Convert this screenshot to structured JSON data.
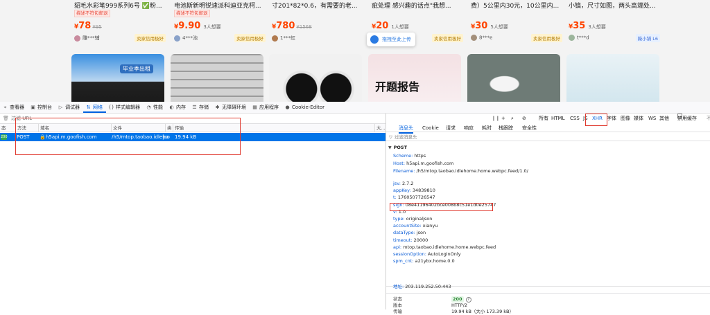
{
  "products": {
    "cards": [
      {
        "title": "貂毛水彩笔999系列6号 ✅粉...",
        "tag": "描述不符包邮退",
        "currency": "¥",
        "price": "78",
        "original": "¥95",
        "wants": "",
        "seller": "雕***辅",
        "badge": "卖家信用极好",
        "badge_type": "credit"
      },
      {
        "title": "电池斯新明锐速派科迪亚克柯...",
        "tag": "描述不符包邮退",
        "currency": "¥",
        "price": "9.90",
        "original": "",
        "wants": "3人想要",
        "seller": "4***池",
        "badge": "卖家信用极好",
        "badge_type": "credit"
      },
      {
        "title": "寸201*82*0.6，有需要的老...",
        "tag": "",
        "currency": "¥",
        "price": "780",
        "original": "¥1568",
        "wants": "",
        "seller": "1***虹",
        "badge": "",
        "badge_type": ""
      },
      {
        "title": "疵处理 感兴趣的话点\"我想...",
        "tag": "",
        "currency": "¥",
        "price": "20",
        "original": "",
        "wants": "1人想要",
        "seller": "",
        "badge": "卖家信用极好",
        "badge_type": "credit"
      },
      {
        "title": "费）5公里内30元，10公里内...",
        "tag": "",
        "currency": "¥",
        "price": "30",
        "original": "",
        "wants": "5人想要",
        "seller": "8***e",
        "badge": "卖家信用极好",
        "badge_type": "credit"
      },
      {
        "title": "小镐，尺寸如图，两头高端处...",
        "tag": "",
        "currency": "¥",
        "price": "35",
        "original": "",
        "wants": "3人想要",
        "seller": "t***d",
        "badge": "薇小铺 L6",
        "badge_type": "level"
      }
    ],
    "thumbs": [
      {
        "caption": "毕业季出租",
        "accent": "#2f6fbf"
      },
      {
        "caption": "",
        "accent": "#b9b9b9"
      },
      {
        "caption": "",
        "accent": "#1e1e1e"
      },
      {
        "caption": "开题报告",
        "accent": "#f2d23c"
      },
      {
        "caption": "",
        "accent": "#7c8a86"
      },
      {
        "caption": "",
        "accent": "#6bc9c6"
      }
    ],
    "upload_tip": "拖拽至此上传"
  },
  "devtools": {
    "tabs": [
      {
        "icon": "⌖",
        "label": "查看器"
      },
      {
        "icon": "▣",
        "label": "控制台"
      },
      {
        "icon": "▷",
        "label": "调试器"
      },
      {
        "icon": "⇅",
        "label": "网络"
      },
      {
        "icon": "{}",
        "label": "样式编辑器"
      },
      {
        "icon": "◔",
        "label": "性能"
      },
      {
        "icon": "◐",
        "label": "内存"
      },
      {
        "icon": "☰",
        "label": "存储"
      },
      {
        "icon": "✱",
        "label": "无障碍环境"
      },
      {
        "icon": "▦",
        "label": "应用程序"
      },
      {
        "icon": "●",
        "label": "Cookie-Editor"
      }
    ],
    "active_tab": "网络",
    "filter_placeholder": "过滤 URL",
    "columns": {
      "status": "态",
      "method": "方法",
      "domain": "域名",
      "file": "文件",
      "initiator": "类",
      "transferred": "传输",
      "size": "大..."
    },
    "request": {
      "status": "200",
      "method": "POST",
      "domain": "h5api.m.goofish.com",
      "file": "/h5/mtop.taobao.idleho",
      "type": "jso",
      "transferred": "19.94 kB"
    },
    "toolbar": {
      "pause": "❙❙",
      "add": "+",
      "search": "⌕",
      "block": "⊘",
      "filters": [
        "所有",
        "HTML",
        "CSS",
        "JS",
        "XHR",
        "字体",
        "图像",
        "媒体",
        "WS",
        "其他"
      ],
      "active_filter": "XHR",
      "disable_cache": "禁用缓存",
      "more": "不"
    },
    "detail_tabs": [
      "消息头",
      "Cookie",
      "请求",
      "响应",
      "耗时",
      "栈跟踪",
      "安全性"
    ],
    "active_detail_tab": "消息头",
    "header_filter_placeholder": "过滤消息头",
    "section_title": "POST",
    "url_parts": [
      {
        "key": "Scheme",
        "value": "https"
      },
      {
        "key": "Host",
        "value": "h5api.m.goofish.com"
      },
      {
        "key": "Filename",
        "value": "/h5/mtop.taobao.idlehome.home.webpc.feed/1.0/"
      }
    ],
    "params": [
      {
        "key": "jsv",
        "value": "2.7.2"
      },
      {
        "key": "appKey",
        "value": "34839810"
      },
      {
        "key": "t",
        "value": "1760507726547"
      },
      {
        "key": "sign",
        "value": "08e41196402bce008b8c51e1d0e25747"
      },
      {
        "key": "v",
        "value": "1.0"
      },
      {
        "key": "type",
        "value": "originaljson"
      },
      {
        "key": "accountSite",
        "value": "xianyu"
      },
      {
        "key": "dataType",
        "value": "json"
      },
      {
        "key": "timeout",
        "value": "20000"
      },
      {
        "key": "api",
        "value": "mtop.taobao.idlehome.home.webpc.feed"
      },
      {
        "key": "sessionOption",
        "value": "AutoLoginOnly"
      },
      {
        "key": "spm_cnt",
        "value": "a21ybx.home.0.0"
      }
    ],
    "address": {
      "key": "地址",
      "value": "203.119.252.50:443"
    },
    "summary": [
      {
        "key": "状态",
        "value": "200"
      },
      {
        "key": "版本",
        "value": "HTTP/2"
      },
      {
        "key": "传输",
        "value": "19.94 kB（大小 173.39 kB）"
      }
    ]
  }
}
